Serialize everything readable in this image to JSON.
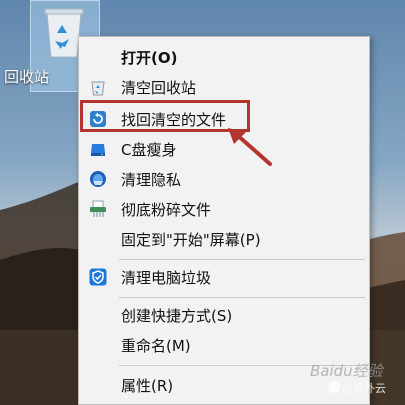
{
  "desktop": {
    "recycle_bin_label": "回收站"
  },
  "context_menu": {
    "items": [
      {
        "label": "打开(O)",
        "icon": "none",
        "bold": true
      },
      {
        "label": "清空回收站",
        "icon": "recycle-bin-icon"
      },
      {
        "label": "找回清空的文件",
        "icon": "restore-files-icon"
      },
      {
        "label": "C盘瘦身",
        "icon": "disk-cleanup-icon"
      },
      {
        "label": "清理隐私",
        "icon": "privacy-cleanup-icon"
      },
      {
        "label": "彻底粉碎文件",
        "icon": "file-shredder-icon"
      },
      {
        "label": "固定到\"开始\"屏幕(P)",
        "icon": "none"
      },
      {
        "label": "清理电脑垃圾",
        "icon": "security-shield-icon"
      },
      {
        "label": "创建快捷方式(S)",
        "icon": "none"
      },
      {
        "label": "重命名(M)",
        "icon": "none"
      },
      {
        "label": "属性(R)",
        "icon": "none"
      }
    ],
    "highlight_color": "#b2362e"
  },
  "watermark": {
    "site": "Baidu经验",
    "brand": "@世外云"
  }
}
